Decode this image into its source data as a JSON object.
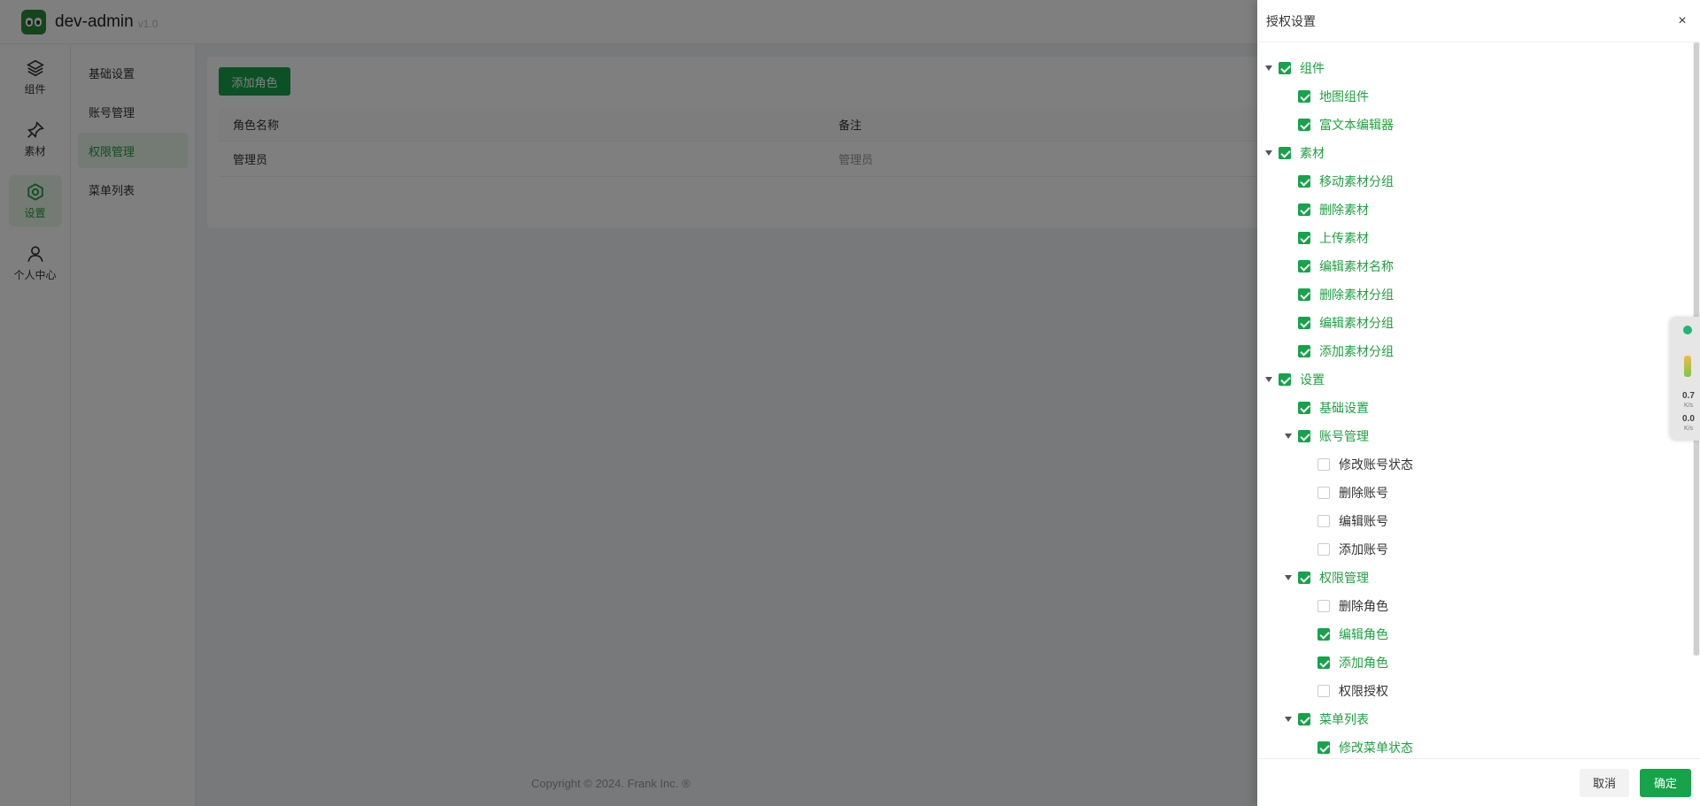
{
  "app": {
    "brand": "dev-admin",
    "version": "v1.0"
  },
  "rail": {
    "items": [
      {
        "label": "组件",
        "icon": "layers-icon",
        "active": false
      },
      {
        "label": "素材",
        "icon": "pin-icon",
        "active": false
      },
      {
        "label": "设置",
        "icon": "settings-icon",
        "active": true
      },
      {
        "label": "个人中心",
        "icon": "user-icon",
        "active": false
      }
    ]
  },
  "submenu": {
    "items": [
      {
        "label": "基础设置",
        "active": false
      },
      {
        "label": "账号管理",
        "active": false
      },
      {
        "label": "权限管理",
        "active": true
      },
      {
        "label": "菜单列表",
        "active": false
      }
    ]
  },
  "content": {
    "add_role_label": "添加角色",
    "table": {
      "headers": [
        "角色名称",
        "备注"
      ],
      "rows": [
        {
          "name": "管理员",
          "note": "管理员"
        }
      ]
    }
  },
  "footer": {
    "copyright": "Copyright © 2024. Frank Inc. ®"
  },
  "drawer": {
    "title": "授权设置",
    "close_label": "×",
    "cancel_label": "取消",
    "ok_label": "确定",
    "tree": [
      {
        "label": "组件",
        "level": 0,
        "expandable": true,
        "checked": true
      },
      {
        "label": "地图组件",
        "level": 1,
        "expandable": false,
        "checked": true
      },
      {
        "label": "富文本编辑器",
        "level": 1,
        "expandable": false,
        "checked": true
      },
      {
        "label": "素材",
        "level": 0,
        "expandable": true,
        "checked": true
      },
      {
        "label": "移动素材分组",
        "level": 1,
        "expandable": false,
        "checked": true
      },
      {
        "label": "删除素材",
        "level": 1,
        "expandable": false,
        "checked": true
      },
      {
        "label": "上传素材",
        "level": 1,
        "expandable": false,
        "checked": true
      },
      {
        "label": "编辑素材名称",
        "level": 1,
        "expandable": false,
        "checked": true
      },
      {
        "label": "删除素材分组",
        "level": 1,
        "expandable": false,
        "checked": true
      },
      {
        "label": "编辑素材分组",
        "level": 1,
        "expandable": false,
        "checked": true
      },
      {
        "label": "添加素材分组",
        "level": 1,
        "expandable": false,
        "checked": true
      },
      {
        "label": "设置",
        "level": 0,
        "expandable": true,
        "checked": true
      },
      {
        "label": "基础设置",
        "level": 1,
        "expandable": false,
        "checked": true
      },
      {
        "label": "账号管理",
        "level": 1,
        "expandable": true,
        "checked": true
      },
      {
        "label": "修改账号状态",
        "level": 2,
        "expandable": false,
        "checked": false
      },
      {
        "label": "删除账号",
        "level": 2,
        "expandable": false,
        "checked": false
      },
      {
        "label": "编辑账号",
        "level": 2,
        "expandable": false,
        "checked": false
      },
      {
        "label": "添加账号",
        "level": 2,
        "expandable": false,
        "checked": false
      },
      {
        "label": "权限管理",
        "level": 1,
        "expandable": true,
        "checked": true
      },
      {
        "label": "删除角色",
        "level": 2,
        "expandable": false,
        "checked": false
      },
      {
        "label": "编辑角色",
        "level": 2,
        "expandable": false,
        "checked": true
      },
      {
        "label": "添加角色",
        "level": 2,
        "expandable": false,
        "checked": true
      },
      {
        "label": "权限授权",
        "level": 2,
        "expandable": false,
        "checked": false
      },
      {
        "label": "菜单列表",
        "level": 1,
        "expandable": true,
        "checked": true
      },
      {
        "label": "修改菜单状态",
        "level": 2,
        "expandable": false,
        "checked": true
      }
    ]
  },
  "net_widget": {
    "up_value": "0.7",
    "up_unit": "K/s",
    "down_value": "0.0",
    "down_unit": "K/s"
  },
  "colors": {
    "accent": "#16a34a",
    "accent_text": "#20a040",
    "mask": "rgba(0,0,0,0.5)"
  }
}
